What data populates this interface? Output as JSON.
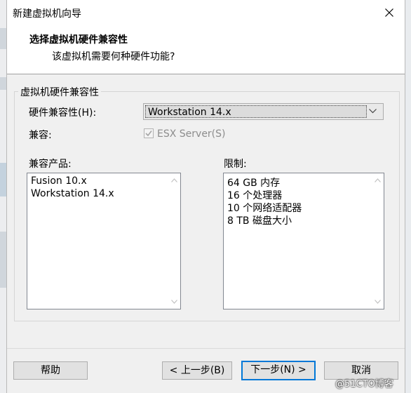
{
  "window": {
    "title": "新建虚拟机向导"
  },
  "header": {
    "title": "选择虚拟机硬件兼容性",
    "subtitle": "该虚拟机需要何种硬件功能?"
  },
  "group": {
    "label": "虚拟机硬件兼容性",
    "compat_label": "硬件兼容性(H):",
    "compat_value": "Workstation 14.x",
    "compatible_label": "兼容:",
    "esx_label": "ESX Server(S)",
    "esx_checked": true,
    "esx_enabled": false
  },
  "products": {
    "label": "兼容产品:",
    "items": [
      "Fusion 10.x",
      "Workstation 14.x"
    ]
  },
  "limits": {
    "label": "限制:",
    "items": [
      "64 GB 内存",
      "16 个处理器",
      "10 个网络适配器",
      "8 TB 磁盘大小"
    ]
  },
  "buttons": {
    "help": "帮助",
    "back": "< 上一步(B)",
    "next": "下一步(N) >",
    "cancel": "取消"
  },
  "watermark": "@51CTO博客",
  "colors": {
    "accent": "#0078d7",
    "dialog_bg": "#f0f0f0"
  }
}
